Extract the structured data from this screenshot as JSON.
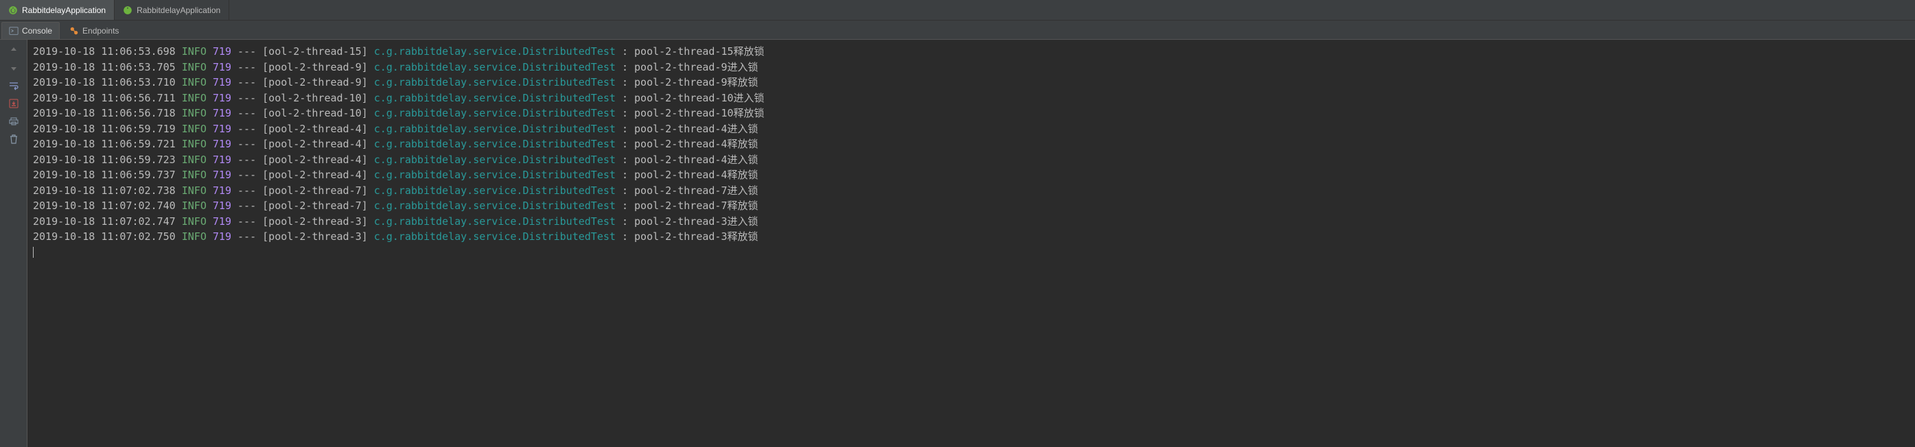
{
  "topTabs": [
    {
      "label": "RabbitdelayApplication",
      "active": true
    },
    {
      "label": "RabbitdelayApplication",
      "active": false
    }
  ],
  "subTabs": [
    {
      "label": "Console",
      "active": true,
      "icon": "console"
    },
    {
      "label": "Endpoints",
      "active": false,
      "icon": "endpoints"
    }
  ],
  "logs": [
    {
      "ts": "2019-10-18 11:06:53.698",
      "level": "INFO",
      "pid": "719",
      "thread": "[ool-2-thread-15]",
      "logger": "c.g.rabbitdelay.service.DistributedTest",
      "msg": "pool-2-thread-15释放锁"
    },
    {
      "ts": "2019-10-18 11:06:53.705",
      "level": "INFO",
      "pid": "719",
      "thread": "[pool-2-thread-9]",
      "logger": "c.g.rabbitdelay.service.DistributedTest",
      "msg": "pool-2-thread-9进入锁"
    },
    {
      "ts": "2019-10-18 11:06:53.710",
      "level": "INFO",
      "pid": "719",
      "thread": "[pool-2-thread-9]",
      "logger": "c.g.rabbitdelay.service.DistributedTest",
      "msg": "pool-2-thread-9释放锁"
    },
    {
      "ts": "2019-10-18 11:06:56.711",
      "level": "INFO",
      "pid": "719",
      "thread": "[ool-2-thread-10]",
      "logger": "c.g.rabbitdelay.service.DistributedTest",
      "msg": "pool-2-thread-10进入锁"
    },
    {
      "ts": "2019-10-18 11:06:56.718",
      "level": "INFO",
      "pid": "719",
      "thread": "[ool-2-thread-10]",
      "logger": "c.g.rabbitdelay.service.DistributedTest",
      "msg": "pool-2-thread-10释放锁"
    },
    {
      "ts": "2019-10-18 11:06:59.719",
      "level": "INFO",
      "pid": "719",
      "thread": "[pool-2-thread-4]",
      "logger": "c.g.rabbitdelay.service.DistributedTest",
      "msg": "pool-2-thread-4进入锁"
    },
    {
      "ts": "2019-10-18 11:06:59.721",
      "level": "INFO",
      "pid": "719",
      "thread": "[pool-2-thread-4]",
      "logger": "c.g.rabbitdelay.service.DistributedTest",
      "msg": "pool-2-thread-4释放锁"
    },
    {
      "ts": "2019-10-18 11:06:59.723",
      "level": "INFO",
      "pid": "719",
      "thread": "[pool-2-thread-4]",
      "logger": "c.g.rabbitdelay.service.DistributedTest",
      "msg": "pool-2-thread-4进入锁"
    },
    {
      "ts": "2019-10-18 11:06:59.737",
      "level": "INFO",
      "pid": "719",
      "thread": "[pool-2-thread-4]",
      "logger": "c.g.rabbitdelay.service.DistributedTest",
      "msg": "pool-2-thread-4释放锁"
    },
    {
      "ts": "2019-10-18 11:07:02.738",
      "level": "INFO",
      "pid": "719",
      "thread": "[pool-2-thread-7]",
      "logger": "c.g.rabbitdelay.service.DistributedTest",
      "msg": "pool-2-thread-7进入锁"
    },
    {
      "ts": "2019-10-18 11:07:02.740",
      "level": "INFO",
      "pid": "719",
      "thread": "[pool-2-thread-7]",
      "logger": "c.g.rabbitdelay.service.DistributedTest",
      "msg": "pool-2-thread-7释放锁"
    },
    {
      "ts": "2019-10-18 11:07:02.747",
      "level": "INFO",
      "pid": "719",
      "thread": "[pool-2-thread-3]",
      "logger": "c.g.rabbitdelay.service.DistributedTest",
      "msg": "pool-2-thread-3进入锁"
    },
    {
      "ts": "2019-10-18 11:07:02.750",
      "level": "INFO",
      "pid": "719",
      "thread": "[pool-2-thread-3]",
      "logger": "c.g.rabbitdelay.service.DistributedTest",
      "msg": "pool-2-thread-3释放锁"
    }
  ],
  "gutterIcons": [
    "up",
    "down",
    "wrap",
    "scroll-to-end",
    "print",
    "trash"
  ]
}
